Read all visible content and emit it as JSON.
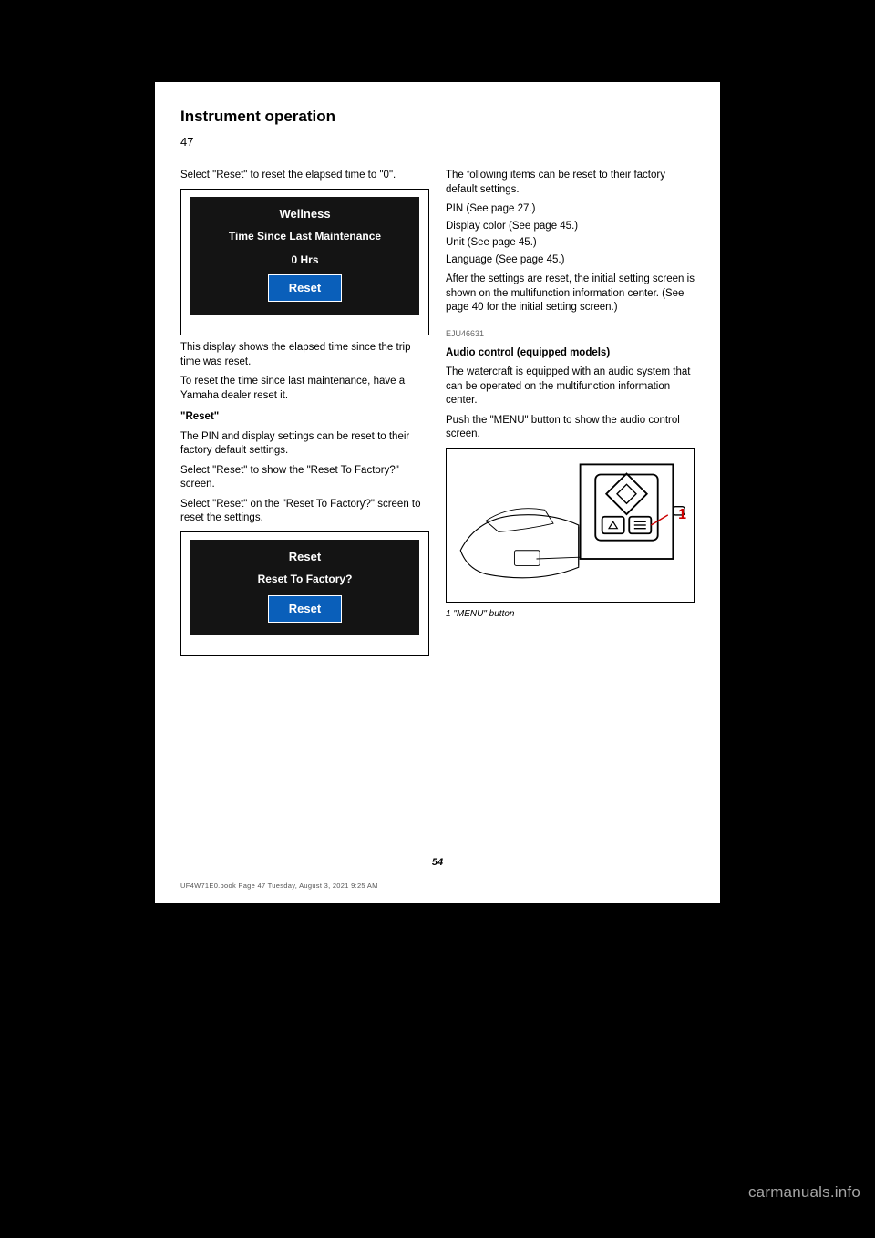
{
  "header": "Instrument operation",
  "page_number_top": "47",
  "left": {
    "p1": "Select \"Reset\" to reset the elapsed time to \"0\".",
    "wellness": {
      "title": "Wellness",
      "subtitle": "Time Since Last Maintenance",
      "value": "0   Hrs",
      "button": "Reset"
    },
    "p2": "This display shows the elapsed time since the trip time was reset.",
    "p3": "To reset the time since last maintenance, have a Yamaha dealer reset it.",
    "reset_sec": {
      "title": "\"Reset\"",
      "p1": "The PIN and display settings can be reset to their factory default settings.",
      "p2": "Select \"Reset\" to show the \"Reset To Factory?\" screen.",
      "p3": "Select \"Reset\" on the \"Reset To Factory?\" screen to reset the settings."
    },
    "reset_lcd": {
      "title": "Reset",
      "subtitle": "Reset To Factory?",
      "button": "Reset"
    }
  },
  "right": {
    "p1": "The following items can be reset to their factory default settings.",
    "items": [
      "PIN (See page 27.)",
      "Display color (See page 45.)",
      "Unit (See page 45.)",
      "Language (See page 45.)"
    ],
    "p2": "After the settings are reset, the initial setting screen is shown on the multifunction information center. (See page 40 for the initial setting screen.)",
    "audio_title": "EJU46631",
    "audio_heading": "Audio control (equipped models)",
    "audio_p1": "The watercraft is equipped with an audio system that can be operated on the multifunction information center.",
    "audio_p2": "Push the \"MENU\" button to show the audio control screen.",
    "diagram_caption": "1 \"MENU\" button"
  },
  "footer_page": "54",
  "print_line": "UF4W71E0.book  Page 47  Tuesday, August 3, 2021  9:25 AM",
  "watermark": "carmanuals.info"
}
